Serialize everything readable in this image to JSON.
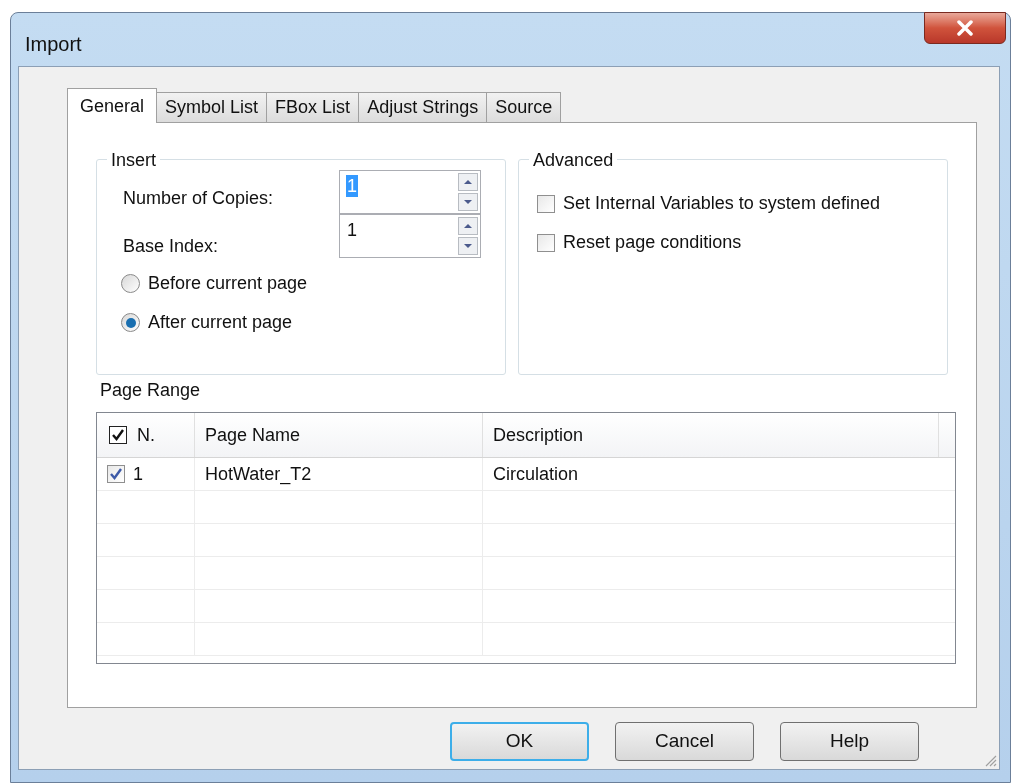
{
  "window": {
    "title": "Import"
  },
  "tabs": [
    {
      "label": "General",
      "selected": true
    },
    {
      "label": "Symbol List",
      "selected": false
    },
    {
      "label": "FBox List",
      "selected": false
    },
    {
      "label": "Adjust Strings",
      "selected": false
    },
    {
      "label": "Source",
      "selected": false
    }
  ],
  "insert": {
    "title": "Insert",
    "fields": [
      {
        "label": "Number of Copies:",
        "value": "1",
        "text_selected": true
      },
      {
        "label": "Base Index:",
        "value": "1",
        "text_selected": false
      }
    ],
    "radios": [
      {
        "label": "Before current page",
        "selected": false
      },
      {
        "label": "After current page",
        "selected": true
      }
    ]
  },
  "advanced": {
    "title": "Advanced",
    "checkboxes": [
      {
        "label": "Set Internal Variables to system defined",
        "checked": false
      },
      {
        "label": "Reset page conditions",
        "checked": false
      }
    ]
  },
  "page_range": {
    "title": "Page Range",
    "header_checked": true,
    "columns": [
      "N.",
      "Page Name",
      "Description"
    ],
    "rows": [
      {
        "checked": true,
        "n": "1",
        "page_name": "HotWater_T2",
        "description": "Circulation"
      }
    ]
  },
  "buttons": [
    {
      "label": "OK",
      "default": true
    },
    {
      "label": "Cancel",
      "default": false
    },
    {
      "label": "Help",
      "default": false
    }
  ]
}
